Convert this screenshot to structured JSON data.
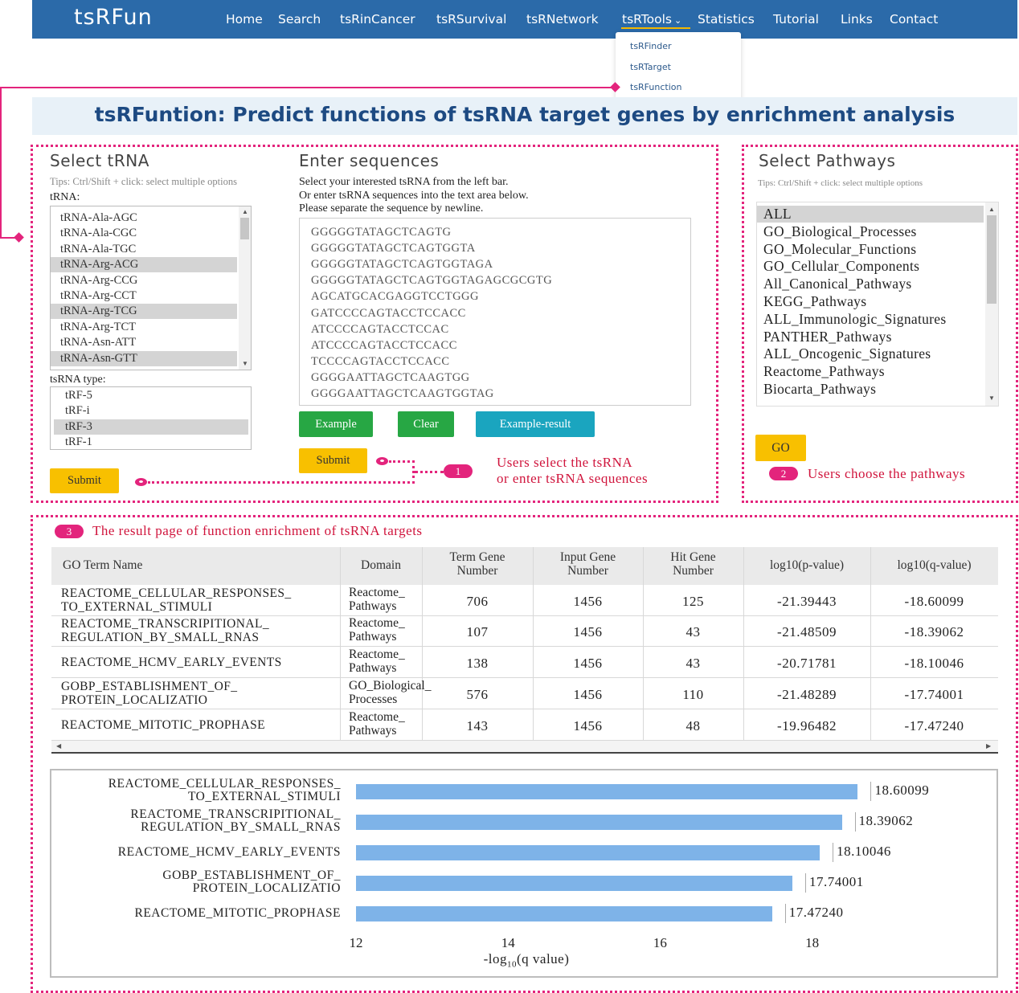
{
  "nav": {
    "brand": "tsRFun",
    "items": [
      "Home",
      "Search",
      "tsRinCancer",
      "tsRSurvival",
      "tsRNetwork",
      "tsRTools",
      "Statistics",
      "Tutorial",
      "Links",
      "Contact"
    ],
    "tools_dropdown": [
      "tsRFinder",
      "tsRTarget",
      "tsRFunction"
    ]
  },
  "page_title": "tsRFuntion: Predict functions of tsRNA target genes by enrichment analysis",
  "select_trna": {
    "heading": "Select tRNA",
    "tips": "Tips: Ctrl/Shift + click: select multiple options",
    "trna_label": "tRNA:",
    "trna_options": [
      {
        "label": "tRNA-Ala-AGC",
        "selected": false
      },
      {
        "label": "tRNA-Ala-CGC",
        "selected": false
      },
      {
        "label": "tRNA-Ala-TGC",
        "selected": false
      },
      {
        "label": "tRNA-Arg-ACG",
        "selected": true
      },
      {
        "label": "tRNA-Arg-CCG",
        "selected": false
      },
      {
        "label": "tRNA-Arg-CCT",
        "selected": false
      },
      {
        "label": "tRNA-Arg-TCG",
        "selected": true
      },
      {
        "label": "tRNA-Arg-TCT",
        "selected": false
      },
      {
        "label": "tRNA-Asn-ATT",
        "selected": false
      },
      {
        "label": "tRNA-Asn-GTT",
        "selected": true
      }
    ],
    "type_label": "tsRNA type:",
    "type_options": [
      {
        "label": "tRF-5",
        "selected": false
      },
      {
        "label": "tRF-i",
        "selected": false
      },
      {
        "label": "tRF-3",
        "selected": true
      },
      {
        "label": "tRF-1",
        "selected": false
      }
    ],
    "submit": "Submit"
  },
  "enter_sequences": {
    "heading": "Enter sequences",
    "instructions": [
      "Select your interested tsRNA from the left bar.",
      "Or enter tsRNA sequences into the text area below.",
      "Please separate the sequence by newline."
    ],
    "sequences": [
      "GGGGGTATAGCTCAGTG",
      "GGGGGTATAGCTCAGTGGTA",
      "GGGGGTATAGCTCAGTGGTAGA",
      "GGGGGTATAGCTCAGTGGTAGAGCGCGTG",
      "AGCATGCACGAGGTCCTGGG",
      "GATCCCCAGTACCTCCACC",
      "ATCCCCAGTACCTCCAC",
      "ATCCCCAGTACCTCCACC",
      "TCCCCAGTACCTCCACC",
      "GGGGAATTAGCTCAAGTGG",
      "GGGGAATTAGCTCAAGTGGTAG"
    ],
    "example": "Example",
    "clear": "Clear",
    "example_result": "Example-result",
    "submit": "Submit"
  },
  "callout1": {
    "badge": "1",
    "line1": "Users select the tsRNA",
    "line2": "or enter tsRNA sequences"
  },
  "select_pathways": {
    "heading": "Select Pathways",
    "tips": "Tips: Ctrl/Shift + click: select multiple options",
    "options": [
      {
        "label": "ALL",
        "selected": true
      },
      {
        "label": "GO_Biological_Processes",
        "selected": false
      },
      {
        "label": "GO_Molecular_Functions",
        "selected": false
      },
      {
        "label": "GO_Cellular_Components",
        "selected": false
      },
      {
        "label": "All_Canonical_Pathways",
        "selected": false
      },
      {
        "label": "KEGG_Pathways",
        "selected": false
      },
      {
        "label": "ALL_Immunologic_Signatures",
        "selected": false
      },
      {
        "label": "PANTHER_Pathways",
        "selected": false
      },
      {
        "label": "ALL_Oncogenic_Signatures",
        "selected": false
      },
      {
        "label": "Reactome_Pathways",
        "selected": false
      },
      {
        "label": "Biocarta_Pathways",
        "selected": false
      }
    ],
    "go": "GO"
  },
  "callout2": {
    "badge": "2",
    "text": "Users choose the pathways"
  },
  "callout3": {
    "badge": "3",
    "text": "The result page of function enrichment of tsRNA targets"
  },
  "results_table": {
    "headers": [
      [
        "GO Term Name"
      ],
      [
        "Domain"
      ],
      [
        "Term Gene",
        "Number"
      ],
      [
        "Input Gene",
        "Number"
      ],
      [
        "Hit Gene",
        "Number"
      ],
      [
        "log10(p-value)"
      ],
      [
        "log10(q-value)"
      ]
    ],
    "rows": [
      {
        "term": [
          "REACTOME_CELLULAR_RESPONSES_",
          "TO_EXTERNAL_STIMULI"
        ],
        "domain": [
          "Reactome_",
          "Pathways"
        ],
        "term_gene": "706",
        "input_gene": "1456",
        "hit_gene": "125",
        "log_p": "-21.39443",
        "log_q": "-18.60099"
      },
      {
        "term": [
          "REACTOME_TRANSCRIPITIONAL_",
          "REGULATION_BY_SMALL_RNAS"
        ],
        "domain": [
          "Reactome_",
          "Pathways"
        ],
        "term_gene": "107",
        "input_gene": "1456",
        "hit_gene": "43",
        "log_p": "-21.48509",
        "log_q": "-18.39062"
      },
      {
        "term": [
          "REACTOME_HCMV_EARLY_EVENTS"
        ],
        "domain": [
          "Reactome_",
          "Pathways"
        ],
        "term_gene": "138",
        "input_gene": "1456",
        "hit_gene": "43",
        "log_p": "-20.71781",
        "log_q": "-18.10046"
      },
      {
        "term": [
          "GOBP_ESTABLISHMENT_OF_",
          "PROTEIN_LOCALIZATIO"
        ],
        "domain": [
          "GO_Biological_",
          "Processes"
        ],
        "term_gene": "576",
        "input_gene": "1456",
        "hit_gene": "110",
        "log_p": "-21.48289",
        "log_q": "-17.74001"
      },
      {
        "term": [
          "REACTOME_MITOTIC_PROPHASE"
        ],
        "domain": [
          "Reactome_",
          "Pathways"
        ],
        "term_gene": "143",
        "input_gene": "1456",
        "hit_gene": "48",
        "log_p": "-19.96482",
        "log_q": "-17.47240"
      }
    ]
  },
  "chart_data": {
    "type": "bar",
    "orientation": "horizontal",
    "categories": [
      [
        "REACTOME_CELLULAR_RESPONSES_",
        "TO_EXTERNAL_STIMULI"
      ],
      [
        "REACTOME_TRANSCRIPITIONAL_",
        "REGULATION_BY_SMALL_RNAS"
      ],
      [
        "REACTOME_HCMV_EARLY_EVENTS"
      ],
      [
        "GOBP_ESTABLISHMENT_OF_",
        "PROTEIN_LOCALIZATIO"
      ],
      [
        "REACTOME_MITOTIC_PROPHASE"
      ]
    ],
    "values": [
      18.60099,
      18.39062,
      18.10046,
      17.74001,
      17.4724
    ],
    "value_labels": [
      "18.60099",
      "18.39062",
      "18.10046",
      "17.74001",
      "17.47240"
    ],
    "xlim": [
      12,
      18.8
    ],
    "xticks": [
      "12",
      "14",
      "16",
      "18"
    ],
    "xlabel_main": "-log",
    "xlabel_sub": "10",
    "xlabel_tail": "(q value)",
    "bar_color": "#7eb3e8",
    "grid": false
  },
  "colors": {
    "nav": "#2b6aa9",
    "accent": "#e3247c",
    "callout_text": "#d0143c",
    "title": "#1d4a82"
  }
}
